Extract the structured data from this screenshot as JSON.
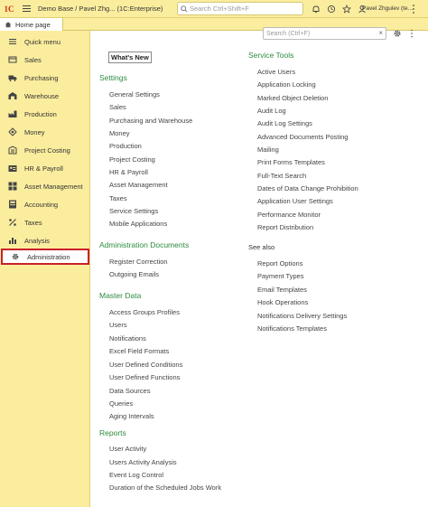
{
  "header": {
    "logo_text": "1C",
    "app_title": "Demo Base / Pavel Zhg... (1C:Enterprise)",
    "search_placeholder": "Search Ctrl+Shift+F",
    "user_name": "Pavel Zhgulev (te..."
  },
  "tabs": {
    "home_label": "Home page"
  },
  "sidebar": {
    "items": [
      {
        "label": "Quick menu",
        "icon": "menu-icon"
      },
      {
        "label": "Sales",
        "icon": "sales-icon"
      },
      {
        "label": "Purchasing",
        "icon": "truck-icon"
      },
      {
        "label": "Warehouse",
        "icon": "warehouse-icon"
      },
      {
        "label": "Production",
        "icon": "production-icon"
      },
      {
        "label": "Money",
        "icon": "money-icon"
      },
      {
        "label": "Project Costing",
        "icon": "project-icon"
      },
      {
        "label": "HR & Payroll",
        "icon": "hr-icon"
      },
      {
        "label": "Asset Management",
        "icon": "asset-icon"
      },
      {
        "label": "Accounting",
        "icon": "accounting-icon"
      },
      {
        "label": "Taxes",
        "icon": "percent-icon"
      },
      {
        "label": "Analysis",
        "icon": "chart-icon"
      },
      {
        "label": "Administration",
        "icon": "gear-icon"
      }
    ],
    "selected": "Administration",
    "selected_color": "#c9202a"
  },
  "content": {
    "search_placeholder": "Search (Ctrl+F)",
    "whats_new": "What's New",
    "settings": {
      "title": "Settings",
      "links": [
        "General Settings",
        "Sales",
        "Purchasing and Warehouse",
        "Money",
        "Production",
        "Project Costing",
        "HR & Payroll",
        "Asset Management",
        "Taxes",
        "Service Settings",
        "Mobile Applications"
      ]
    },
    "admin_docs": {
      "title": "Administration Documents",
      "links": [
        "Register Correction",
        "Outgoing Emails"
      ]
    },
    "master_data": {
      "title": "Master Data",
      "links": [
        "Access Groups Profiles",
        "Users",
        "Notifications",
        "Excel Field Formats",
        "User Defined Conditions",
        "User Defined Functions",
        "Data Sources",
        "Queries",
        "Aging Intervals"
      ]
    },
    "reports": {
      "title": "Reports",
      "links": [
        "User Activity",
        "Users Activity Analysis",
        "Event Log Control",
        "Duration of the Scheduled Jobs Work"
      ]
    },
    "service_tools": {
      "title": "Service Tools",
      "links": [
        "Active Users",
        "Application Locking",
        "Marked Object Deletion",
        "Audit Log",
        "Audit Log Settings",
        "Advanced Documents Posting",
        "Mailing",
        "Print Forms Templates",
        "Full-Text Search",
        "Dates of Data Change Prohibition",
        "Application User Settings",
        "Performance Monitor",
        "Report Distribution"
      ]
    },
    "see_also": {
      "title": "See also",
      "links": [
        "Report Options",
        "Payment Types",
        "Email Templates",
        "Hook Operations",
        "Notifications Delivery Settings",
        "Notifications Templates"
      ]
    },
    "section_color": "#2e8b3f"
  }
}
